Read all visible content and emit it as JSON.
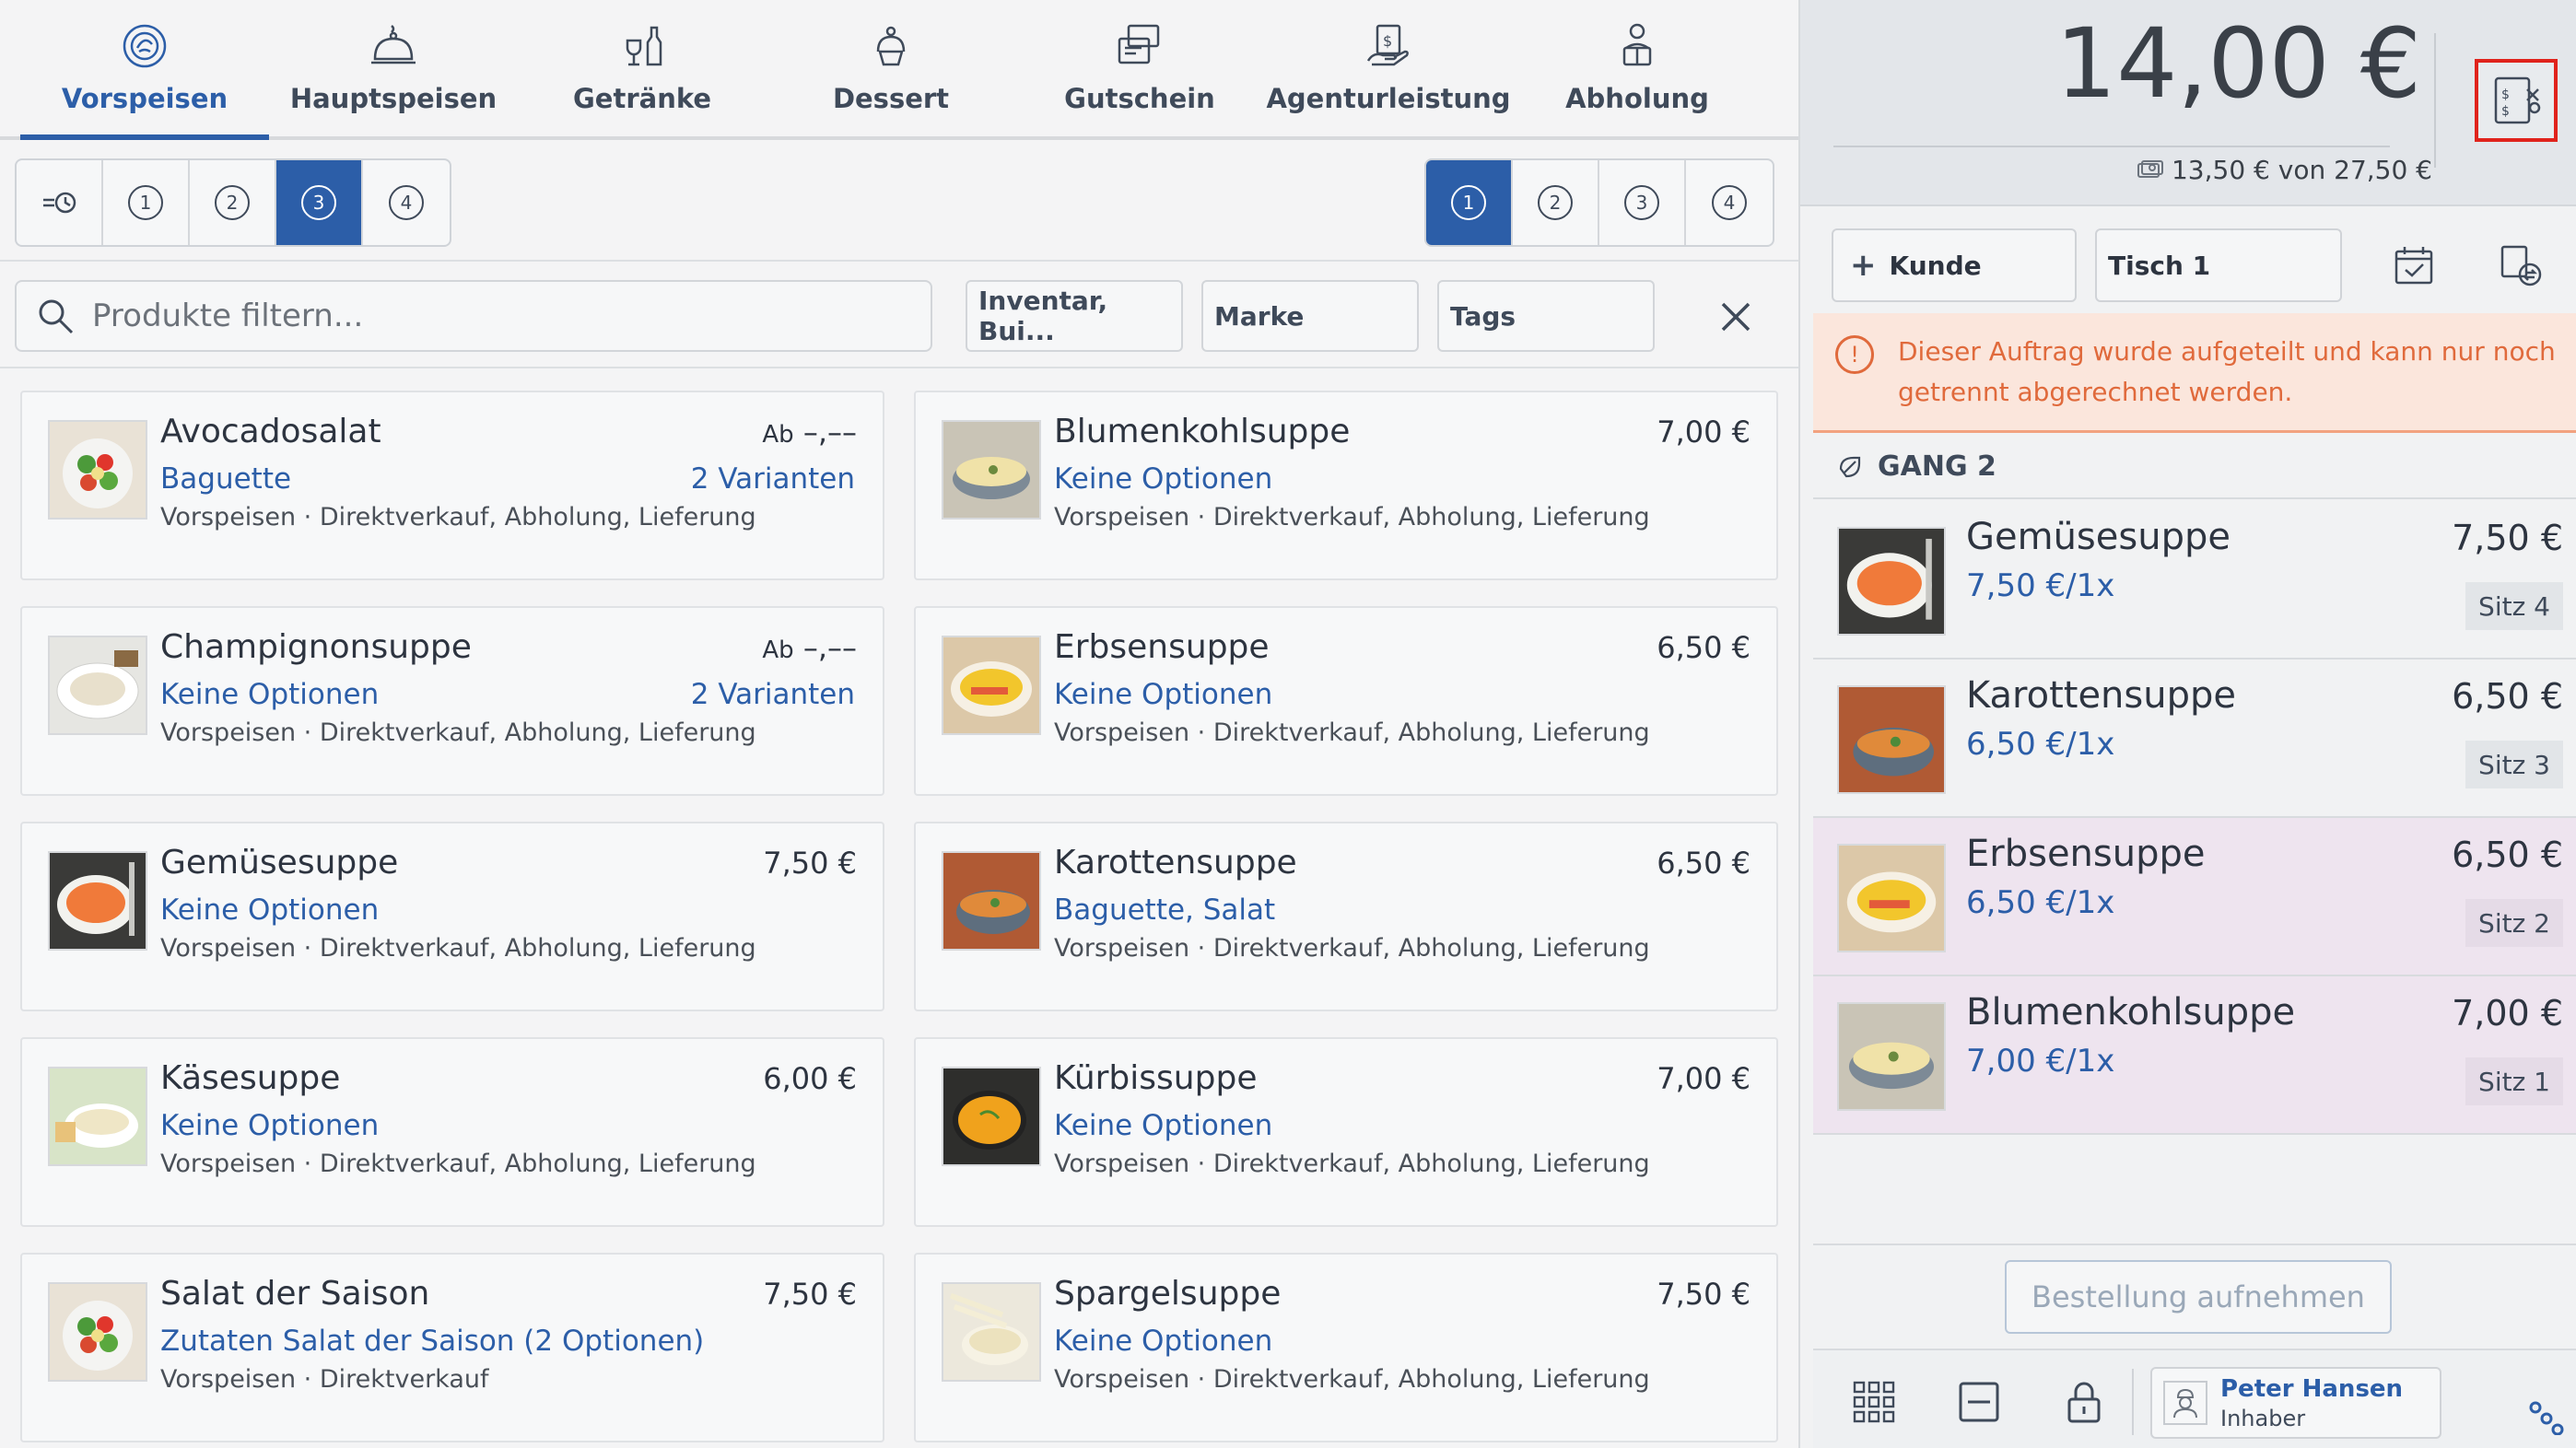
{
  "categories": [
    {
      "label": "Vorspeisen",
      "icon": "salad-plate-icon",
      "active": true
    },
    {
      "label": "Hauptspeisen",
      "icon": "cloche-icon",
      "active": false
    },
    {
      "label": "Getränke",
      "icon": "drinks-icon",
      "active": false
    },
    {
      "label": "Dessert",
      "icon": "dessert-icon",
      "active": false
    },
    {
      "label": "Gutschein",
      "icon": "voucher-icon",
      "active": false
    },
    {
      "label": "Agenturleistung",
      "icon": "agency-service-icon",
      "active": false
    },
    {
      "label": "Abholung",
      "icon": "pickup-icon",
      "active": false
    }
  ],
  "course_filter": [
    "1",
    "2",
    "3",
    "4"
  ],
  "course_filter_active": "3",
  "seat_filter": [
    "1",
    "2",
    "3",
    "4"
  ],
  "seat_filter_active": "1",
  "search": {
    "placeholder": "Produkte filtern..."
  },
  "filters": {
    "inventory": "Inventar, Bui...",
    "brand": "Marke",
    "tags": "Tags"
  },
  "products": [
    {
      "name": "Avocadosalat",
      "price_prefix": "Ab",
      "price": "–,––",
      "options": "Baguette",
      "variants": "2 Varianten",
      "meta": "Vorspeisen · Direktverkauf, Abholung, Lieferung",
      "img": "salad"
    },
    {
      "name": "Blumenkohlsuppe",
      "price_prefix": "",
      "price": "7,00 €",
      "options": "Keine Optionen",
      "variants": "",
      "meta": "Vorspeisen · Direktverkauf, Abholung, Lieferung",
      "img": "cream-soup"
    },
    {
      "name": "Champignonsuppe",
      "price_prefix": "Ab",
      "price": "–,––",
      "options": "Keine Optionen",
      "variants": "2 Varianten",
      "meta": "Vorspeisen · Direktverkauf, Abholung, Lieferung",
      "img": "white-soup"
    },
    {
      "name": "Erbsensuppe",
      "price_prefix": "",
      "price": "6,50 €",
      "options": "Keine Optionen",
      "variants": "",
      "meta": "Vorspeisen · Direktverkauf, Abholung, Lieferung",
      "img": "omelette"
    },
    {
      "name": "Gemüsesuppe",
      "price_prefix": "",
      "price": "7,50 €",
      "options": "Keine Optionen",
      "variants": "",
      "meta": "Vorspeisen · Direktverkauf, Abholung, Lieferung",
      "img": "tomato-soup"
    },
    {
      "name": "Karottensuppe",
      "price_prefix": "",
      "price": "6,50 €",
      "options": "Baguette, Salat",
      "variants": "",
      "meta": "Vorspeisen · Direktverkauf, Abholung, Lieferung",
      "img": "bowl-soup"
    },
    {
      "name": "Käsesuppe",
      "price_prefix": "",
      "price": "6,00 €",
      "options": "Keine Optionen",
      "variants": "",
      "meta": "Vorspeisen · Direktverkauf, Abholung, Lieferung",
      "img": "cheese-soup"
    },
    {
      "name": "Kürbissuppe",
      "price_prefix": "",
      "price": "7,00 €",
      "options": "Keine Optionen",
      "variants": "",
      "meta": "Vorspeisen · Direktverkauf, Abholung, Lieferung",
      "img": "pumpkin-soup"
    },
    {
      "name": "Salat der Saison",
      "price_prefix": "",
      "price": "7,50 €",
      "options": "Zutaten Salat der Saison (2 Optionen)",
      "variants": "",
      "meta": "Vorspeisen · Direktverkauf",
      "img": "salad"
    },
    {
      "name": "Spargelsuppe",
      "price_prefix": "",
      "price": "7,50 €",
      "options": "Keine Optionen",
      "variants": "",
      "meta": "Vorspeisen · Direktverkauf, Abholung, Lieferung",
      "img": "asparagus-soup"
    }
  ],
  "summary": {
    "total": "14,00 €",
    "paid": "13,50 €",
    "of_label": "von",
    "grand_total": "27,50 €"
  },
  "controls": {
    "customer": "Kunde",
    "table": "Tisch 1"
  },
  "warning": "Dieser Auftrag wurde aufgeteilt und kann nur noch getrennt abgerechnet werden.",
  "course_header": "GANG 2",
  "order_items": [
    {
      "name": "Gemüsesuppe",
      "unit": "7,50 €/1x",
      "price": "7,50 €",
      "seat": "Sitz 4",
      "highlight": false,
      "img": "tomato-soup"
    },
    {
      "name": "Karottensuppe",
      "unit": "6,50 €/1x",
      "price": "6,50 €",
      "seat": "Sitz 3",
      "highlight": false,
      "img": "bowl-soup"
    },
    {
      "name": "Erbsensuppe",
      "unit": "6,50 €/1x",
      "price": "6,50 €",
      "seat": "Sitz 2",
      "highlight": true,
      "img": "omelette"
    },
    {
      "name": "Blumenkohlsuppe",
      "unit": "7,00 €/1x",
      "price": "7,00 €",
      "seat": "Sitz 1",
      "highlight": true,
      "img": "cream-soup"
    }
  ],
  "take_order": "Bestellung aufnehmen",
  "user": {
    "name": "Peter Hansen",
    "role": "Inhaber"
  },
  "colors": {
    "accent": "#2c5ea8",
    "warning": "#e06a3c",
    "highlight_row": "#eee4ef",
    "split_outline": "#e0231c"
  }
}
